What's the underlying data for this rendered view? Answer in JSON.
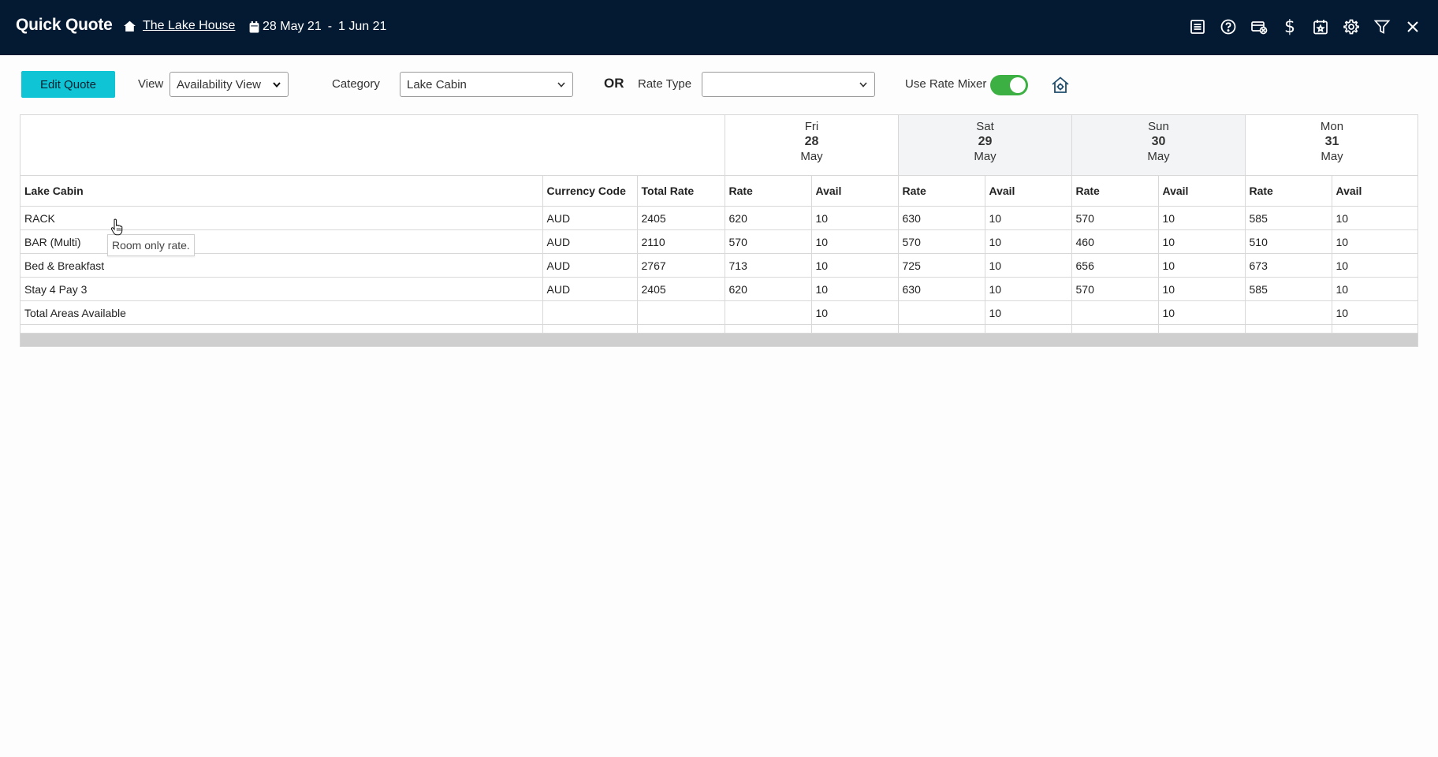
{
  "header": {
    "title": "Quick Quote",
    "property": "The Lake House",
    "date_from": "28 May 21",
    "date_sep": "-",
    "date_to": "1 Jun 21",
    "icons": [
      "list-icon",
      "help-icon",
      "payment-icon",
      "dollar-icon",
      "calendar-star-icon",
      "gear-icon",
      "filter-icon",
      "close-icon"
    ],
    "dollar_glyph": "$"
  },
  "toolbar": {
    "edit_label": "Edit Quote",
    "view_label": "View",
    "view_value": "Availability View",
    "category_label": "Category",
    "category_value": "Lake Cabin",
    "or_label": "OR",
    "rate_type_label": "Rate Type",
    "rate_type_value": "",
    "rate_mixer_label": "Use Rate Mixer",
    "rate_mixer_on": true
  },
  "grid": {
    "dates": [
      {
        "dow": "Fri",
        "day": "28",
        "month": "May"
      },
      {
        "dow": "Sat",
        "day": "29",
        "month": "May"
      },
      {
        "dow": "Sun",
        "day": "30",
        "month": "May"
      },
      {
        "dow": "Mon",
        "day": "31",
        "month": "May"
      }
    ],
    "columns": [
      "Lake Cabin",
      "Currency Code",
      "Total Rate",
      "Rate",
      "Avail",
      "Rate",
      "Avail",
      "Rate",
      "Avail",
      "Rate",
      "Avail"
    ],
    "rows": [
      [
        "RACK",
        "AUD",
        "2405",
        "620",
        "10",
        "630",
        "10",
        "570",
        "10",
        "585",
        "10"
      ],
      [
        "BAR (Multi)",
        "AUD",
        "2110",
        "570",
        "10",
        "570",
        "10",
        "460",
        "10",
        "510",
        "10"
      ],
      [
        "Bed & Breakfast",
        "AUD",
        "2767",
        "713",
        "10",
        "725",
        "10",
        "656",
        "10",
        "673",
        "10"
      ],
      [
        "Stay 4 Pay 3",
        "AUD",
        "2405",
        "620",
        "10",
        "630",
        "10",
        "570",
        "10",
        "585",
        "10"
      ],
      [
        "Total Areas Available",
        "",
        "",
        "",
        "10",
        "",
        "10",
        "",
        "10",
        "",
        "10"
      ]
    ]
  },
  "tooltip": "Room only rate.",
  "colors": {
    "header_bg": "#041a33",
    "accent": "#0fc4d4",
    "toggle_on": "#3cb043"
  }
}
